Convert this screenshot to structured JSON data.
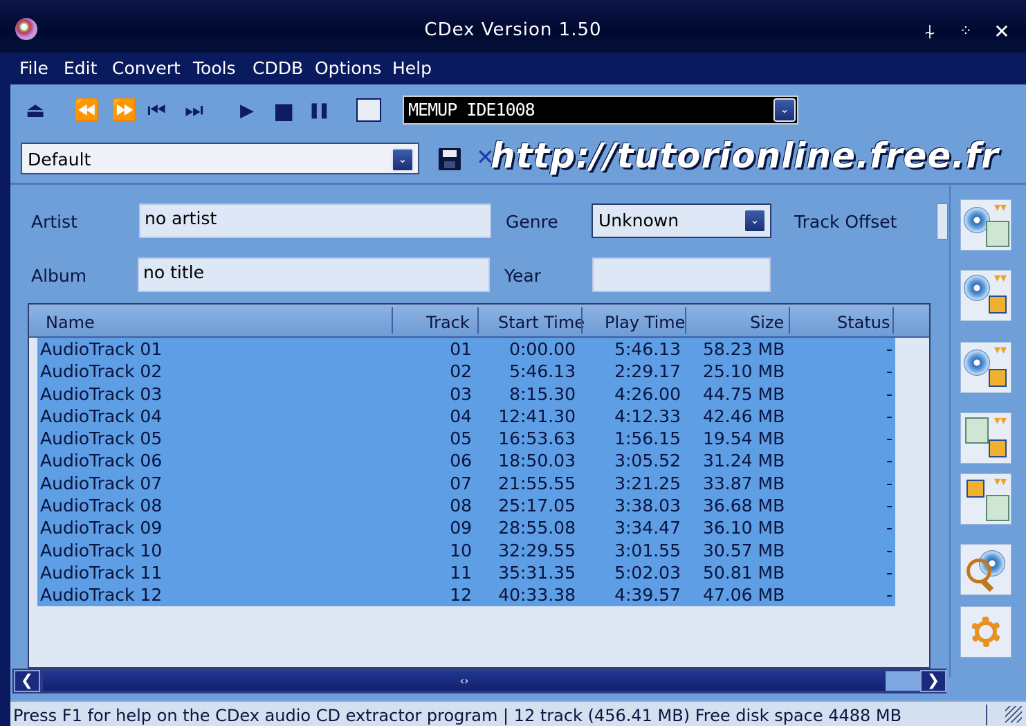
{
  "window": {
    "title": "CDex Version 1.50",
    "controls": [
      "⍭",
      "⁘",
      "✕"
    ]
  },
  "menubar": {
    "items": [
      "File",
      "Edit",
      "Convert",
      "Tools",
      "CDDB",
      "Options",
      "Help"
    ]
  },
  "toolbar": {
    "drive": "MEMUP  IDE1008"
  },
  "profile": {
    "selected": "Default",
    "watermark": "http://tutorionline.free.fr"
  },
  "form": {
    "artist_label": "Artist",
    "artist_value": "no artist",
    "album_label": "Album",
    "album_value": "no title",
    "genre_label": "Genre",
    "genre_value": "Unknown",
    "year_label": "Year",
    "year_value": "",
    "track_offset_label": "Track Offset"
  },
  "list": {
    "columns": [
      "Name",
      "Track",
      "Start Time",
      "Play Time",
      "Size",
      "Status"
    ],
    "rows": [
      {
        "name": "AudioTrack 01",
        "track": "01",
        "start": "0:00.00",
        "play": "5:46.13",
        "size": "58.23 MB",
        "status": "-"
      },
      {
        "name": "AudioTrack 02",
        "track": "02",
        "start": "5:46.13",
        "play": "2:29.17",
        "size": "25.10 MB",
        "status": "-"
      },
      {
        "name": "AudioTrack 03",
        "track": "03",
        "start": "8:15.30",
        "play": "4:26.00",
        "size": "44.75 MB",
        "status": "-"
      },
      {
        "name": "AudioTrack 04",
        "track": "04",
        "start": "12:41.30",
        "play": "4:12.33",
        "size": "42.46 MB",
        "status": "-"
      },
      {
        "name": "AudioTrack 05",
        "track": "05",
        "start": "16:53.63",
        "play": "1:56.15",
        "size": "19.54 MB",
        "status": "-"
      },
      {
        "name": "AudioTrack 06",
        "track": "06",
        "start": "18:50.03",
        "play": "3:05.52",
        "size": "31.24 MB",
        "status": "-"
      },
      {
        "name": "AudioTrack 07",
        "track": "07",
        "start": "21:55.55",
        "play": "3:21.25",
        "size": "33.87 MB",
        "status": "-"
      },
      {
        "name": "AudioTrack 08",
        "track": "08",
        "start": "25:17.05",
        "play": "3:38.03",
        "size": "36.68 MB",
        "status": "-"
      },
      {
        "name": "AudioTrack 09",
        "track": "09",
        "start": "28:55.08",
        "play": "3:34.47",
        "size": "36.10 MB",
        "status": "-"
      },
      {
        "name": "AudioTrack 10",
        "track": "10",
        "start": "32:29.55",
        "play": "3:01.55",
        "size": "30.57 MB",
        "status": "-"
      },
      {
        "name": "AudioTrack 11",
        "track": "11",
        "start": "35:31.35",
        "play": "5:02.03",
        "size": "50.81 MB",
        "status": "-"
      },
      {
        "name": "AudioTrack 12",
        "track": "12",
        "start": "40:33.38",
        "play": "4:39.57",
        "size": "47.06 MB",
        "status": "-"
      }
    ]
  },
  "statusbar": {
    "text": "Press F1 for help on the CDex audio CD extractor program | 12 track (456.41 MB) Free disk space  4488 MB"
  },
  "icons": {
    "eject": "⏏",
    "rewind": "⏪",
    "fast_forward": "⏩",
    "prev": "⏮",
    "next": "⏭",
    "play": "▶",
    "stop": "■",
    "pause": "❚❚",
    "dropdown": "⌄",
    "delete": "✕",
    "scroll_left": "❮",
    "scroll_right": "❯",
    "scroll_thumb": "‹›"
  },
  "colors": {
    "window_bg": "#6e9fd8",
    "titlebar": "#000a30",
    "row_bg": "#5d9ee4"
  }
}
